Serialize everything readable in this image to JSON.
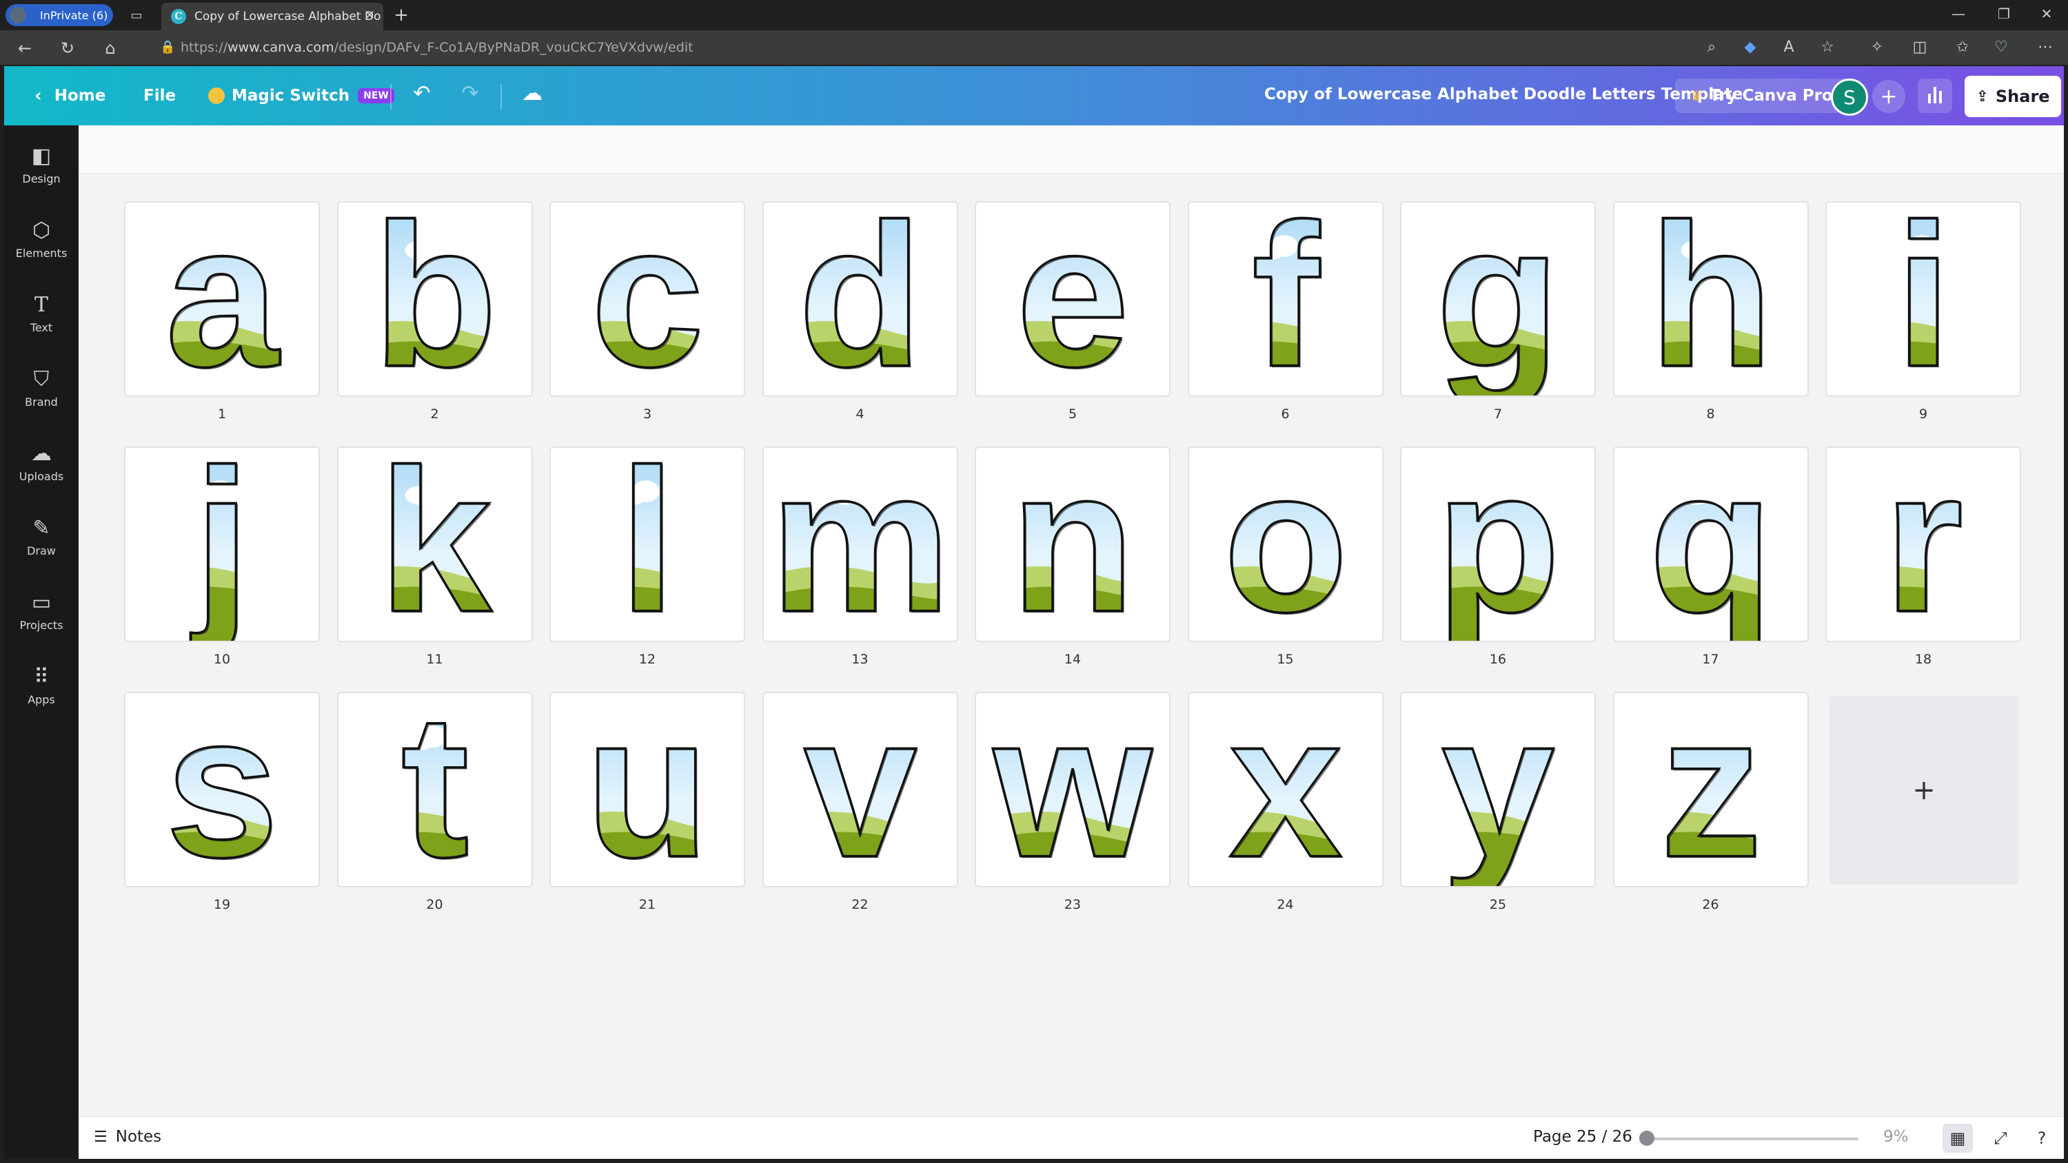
{
  "browser": {
    "inprivate_label": "InPrivate (6)",
    "tab_title": "Copy of Lowercase Alphabet Do",
    "url_prefix": "https://",
    "url_host": "www.canva.com",
    "url_path": "/design/DAFv_F-Co1A/ByPNaDR_vouCkC7YeVXdvw/edit"
  },
  "header": {
    "home": "Home",
    "file": "File",
    "magic_switch": "Magic Switch",
    "new_badge": "NEW",
    "doc_title": "Copy of Lowercase Alphabet Doodle Letters Template",
    "try_pro": "Try Canva Pro",
    "avatar_initial": "S",
    "share": "Share"
  },
  "sidebar": {
    "items": [
      {
        "label": "Design",
        "icon": "design-icon"
      },
      {
        "label": "Elements",
        "icon": "elements-icon"
      },
      {
        "label": "Text",
        "icon": "text-icon"
      },
      {
        "label": "Brand",
        "icon": "brand-icon"
      },
      {
        "label": "Uploads",
        "icon": "uploads-icon"
      },
      {
        "label": "Draw",
        "icon": "draw-icon"
      },
      {
        "label": "Projects",
        "icon": "projects-icon"
      },
      {
        "label": "Apps",
        "icon": "apps-icon"
      }
    ]
  },
  "pages": [
    {
      "letter": "a",
      "num": "1"
    },
    {
      "letter": "b",
      "num": "2"
    },
    {
      "letter": "c",
      "num": "3"
    },
    {
      "letter": "d",
      "num": "4"
    },
    {
      "letter": "e",
      "num": "5"
    },
    {
      "letter": "f",
      "num": "6"
    },
    {
      "letter": "g",
      "num": "7"
    },
    {
      "letter": "h",
      "num": "8"
    },
    {
      "letter": "i",
      "num": "9"
    },
    {
      "letter": "j",
      "num": "10"
    },
    {
      "letter": "k",
      "num": "11"
    },
    {
      "letter": "l",
      "num": "12"
    },
    {
      "letter": "m",
      "num": "13"
    },
    {
      "letter": "n",
      "num": "14"
    },
    {
      "letter": "o",
      "num": "15"
    },
    {
      "letter": "p",
      "num": "16"
    },
    {
      "letter": "q",
      "num": "17"
    },
    {
      "letter": "r",
      "num": "18"
    },
    {
      "letter": "s",
      "num": "19"
    },
    {
      "letter": "t",
      "num": "20"
    },
    {
      "letter": "u",
      "num": "21"
    },
    {
      "letter": "v",
      "num": "22"
    },
    {
      "letter": "w",
      "num": "23"
    },
    {
      "letter": "x",
      "num": "24"
    },
    {
      "letter": "y",
      "num": "25"
    },
    {
      "letter": "z",
      "num": "26"
    }
  ],
  "add_page_symbol": "+",
  "footer": {
    "notes": "Notes",
    "page_indicator": "Page 25 / 26",
    "zoom": "9%"
  },
  "colors": {
    "sky_top": "#a9d8f5",
    "sky_bottom": "#e4f4fd",
    "grass_light": "#b9d36a",
    "grass_dark": "#7ea21a"
  }
}
